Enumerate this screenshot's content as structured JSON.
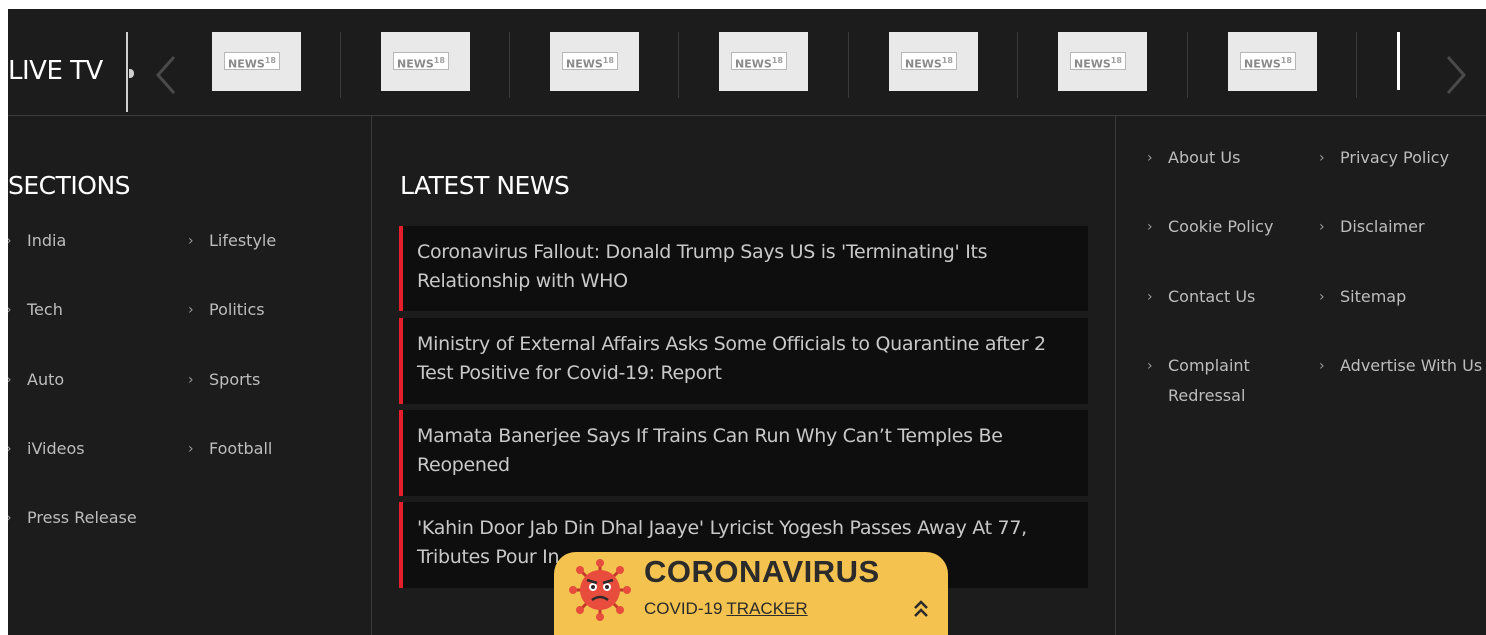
{
  "live_tv": {
    "label": "LIVE TV",
    "channels": [
      {
        "logo": "NEWS",
        "suffix": "18"
      },
      {
        "logo": "NEWS",
        "suffix": "18"
      },
      {
        "logo": "NEWS",
        "suffix": "18"
      },
      {
        "logo": "NEWS",
        "suffix": "18"
      },
      {
        "logo": "NEWS",
        "suffix": "18"
      },
      {
        "logo": "NEWS",
        "suffix": "18"
      },
      {
        "logo": "NEWS",
        "suffix": "18"
      }
    ]
  },
  "sections": {
    "title": "SECTIONS",
    "links": [
      "India",
      "Lifestyle",
      "Tech",
      "Politics",
      "Auto",
      "Sports",
      "iVideos",
      "Football",
      "Press Release"
    ]
  },
  "latest_news": {
    "title": "LATEST NEWS",
    "items": [
      "Coronavirus Fallout: Donald Trump Says US is 'Terminating' Its Relationship with WHO",
      "Ministry of External Affairs Asks Some Officials to Quarantine after 2 Test Positive for Covid-19: Report",
      "Mamata Banerjee Says If Trains Can Run Why Can’t Temples Be Reopened",
      "'Kahin Door Jab Din Dhal Jaaye' Lyricist Yogesh Passes Away At 77, Tributes Pour In"
    ]
  },
  "footer_links": {
    "items": [
      "About Us",
      "Privacy Policy",
      "Cookie Policy",
      "Disclaimer",
      "Contact Us",
      "Sitemap",
      "Complaint Redressal",
      "Advertise With Us"
    ]
  },
  "tracker": {
    "title": "CORONAVIRUS",
    "sub_prefix": "COVID-19",
    "sub_link": "TRACKER"
  },
  "colors": {
    "background": "#1c1c1c",
    "news_item_bg": "#0e0e0e",
    "accent_red": "#e41f2b",
    "tracker_yellow": "#f4c24f"
  },
  "icons": [
    "chevron-left-icon",
    "chevron-right-icon",
    "link-chevron-icon",
    "virus-icon",
    "double-chevron-up-icon"
  ]
}
